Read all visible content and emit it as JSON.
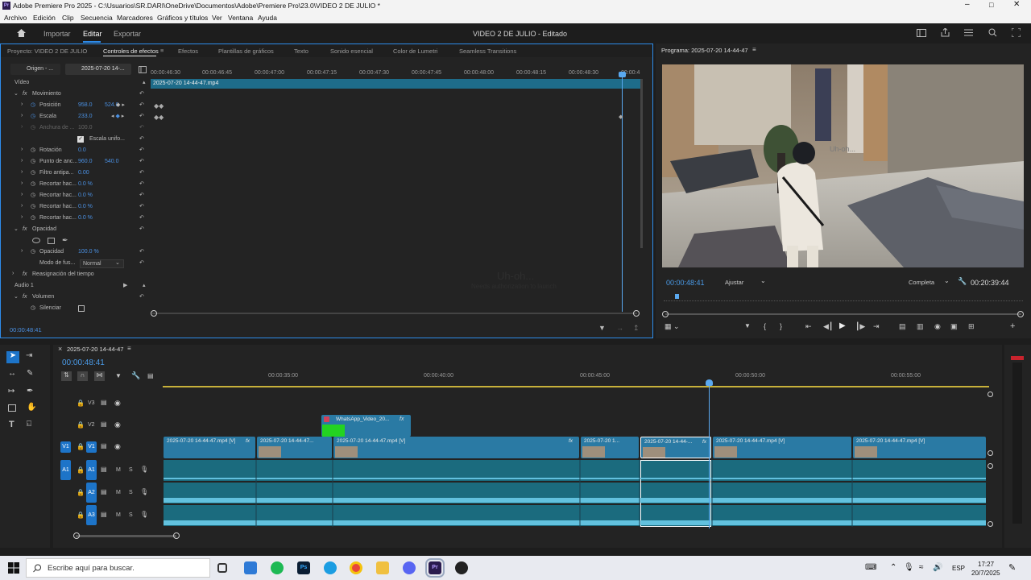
{
  "window": {
    "title": "Adobe Premiere Pro 2025 - C:\\Usuarios\\SR.DARI\\OneDrive\\Documentos\\Adobe\\Premiere Pro\\23.0\\VIDEO 2 DE JULIO *",
    "app_icon": "Pr"
  },
  "menu": [
    "Archivo",
    "Edición",
    "Clip",
    "Secuencia",
    "Marcadores",
    "Gráficos y títulos",
    "Ver",
    "Ventana",
    "Ayuda"
  ],
  "workspace": {
    "tabs": [
      "Importar",
      "Editar",
      "Exportar"
    ],
    "active": "Editar",
    "title": "VIDEO 2 DE JULIO - Editado"
  },
  "source_panel": {
    "tabs": [
      "Proyecto: VIDEO 2 DE JULIO",
      "Controles de efectos",
      "Efectos",
      "Plantillas de gráficos",
      "Texto",
      "Sonido esencial",
      "Color de Lumetri",
      "Seamless Transitions"
    ],
    "source_dropdown": "Origen - ...",
    "sequence_dropdown": "2025-07-20 14-...",
    "ruler": [
      "00:00:46:30",
      "00:00:46:45",
      "00:00:47:00",
      "00:00:47:15",
      "00:00:47:30",
      "00:00:47:45",
      "00:00:48:00",
      "00:00:48:15",
      "00:00:48:30",
      "00:00:4"
    ],
    "clip_name": "2025-07-20 14-44-47.mp4",
    "timecode": "00:00:48:41",
    "ghost_text": [
      "Uh-oh...",
      "Needs authorization to launch"
    ]
  },
  "effect_controls": {
    "video_header": "Vídeo",
    "motion": "Movimiento",
    "position": {
      "label": "Posición",
      "x": "958.0",
      "y": "524.0"
    },
    "scale": {
      "label": "Escala",
      "value": "233.0"
    },
    "scale_width": {
      "label": "Anchura de ...",
      "value": "100.0"
    },
    "uniform_scale": "Escala unifo...",
    "rotation": {
      "label": "Rotación",
      "value": "0.0"
    },
    "anchor": {
      "label": "Punto de anc...",
      "x": "960.0",
      "y": "540.0"
    },
    "antiflicker": {
      "label": "Filtro antipa...",
      "value": "0.00"
    },
    "crops": [
      {
        "label": "Recortar hac...",
        "value": "0.0 %"
      },
      {
        "label": "Recortar hac...",
        "value": "0.0 %"
      },
      {
        "label": "Recortar hac...",
        "value": "0.0 %"
      },
      {
        "label": "Recortar hac...",
        "value": "0.0 %"
      }
    ],
    "opacity_group": "Opacidad",
    "opacity": {
      "label": "Opacidad",
      "value": "100.0 %"
    },
    "blend": {
      "label": "Modo de fus...",
      "value": "Normal"
    },
    "time_remap": "Reasignación del tiempo",
    "audio_header": "Audio 1",
    "volume": "Volumen",
    "mute": "Silenciar"
  },
  "program": {
    "title": "Programa: 2025-07-20 14-44-47",
    "timecode": "00:00:48:41",
    "fit": "Ajustar",
    "quality": "Completa",
    "duration": "00:20:39:44"
  },
  "timeline": {
    "sequence": "2025-07-20 14-44-47",
    "timecode": "00:00:48:41",
    "ruler": [
      "00:00:35:00",
      "00:00:40:00",
      "00:00:45:00",
      "00:00:50:00",
      "00:00:55:00"
    ],
    "tracks": {
      "v3": "V3",
      "v2": "V2",
      "v1": "V1",
      "a1": "A1",
      "a2": "A2",
      "a3": "A3",
      "m": "M",
      "s": "S",
      "src_v1": "V1",
      "src_a1": "A1"
    },
    "overlay_clip": "WhatsApp_Video_20...",
    "video_clips": [
      "2025-07-20 14-44-47.mp4 [V]",
      "2025-07-20 14-44-47...",
      "2025-07-20 14-44-47.mp4 [V]",
      "2025-07-20 1...",
      "2025-07-20 14-44-...",
      "2025-07-20 14-44-47.mp4 [V]",
      "2025-07-20 14-44-47.mp4 [V]"
    ],
    "fx": "fx"
  },
  "taskbar": {
    "search": "Escribe aquí para buscar.",
    "lang": "ESP",
    "time": "17:27",
    "date": "20/7/2025"
  },
  "colors": {
    "accent": "#2d8ceb",
    "clip_video": "#2a7aa4",
    "clip_audio": "#1b6b7e",
    "green_clip": "#23d321",
    "playhead": "#5aa9f0"
  }
}
